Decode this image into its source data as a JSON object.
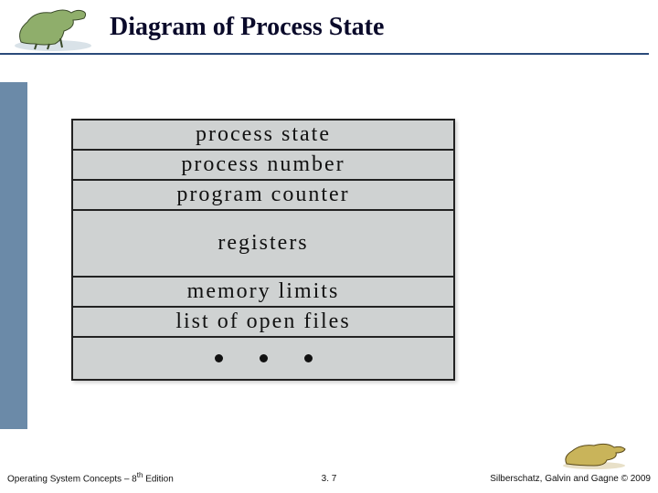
{
  "title": "Diagram of Process State",
  "pcb": {
    "rows": [
      {
        "label": "process state",
        "tall": false
      },
      {
        "label": "process number",
        "tall": false
      },
      {
        "label": "program counter",
        "tall": false
      },
      {
        "label": "registers",
        "tall": true
      },
      {
        "label": "memory limits",
        "tall": false
      },
      {
        "label": "list of open files",
        "tall": false
      }
    ],
    "ellipsis_dots": 3
  },
  "footer": {
    "left_prefix": "Operating System Concepts – 8",
    "left_suffix": " Edition",
    "left_sup": "th",
    "center": "3. 7",
    "right": "Silberschatz, Galvin and Gagne © 2009"
  }
}
